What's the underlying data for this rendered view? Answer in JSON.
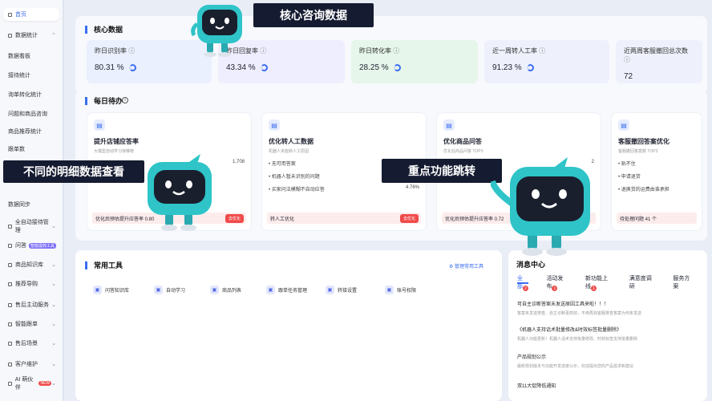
{
  "sidebar": {
    "items": [
      {
        "label": "首页",
        "active": true
      },
      {
        "label": "数据统计",
        "chevron": "⌃"
      },
      {
        "label": "数据看板"
      },
      {
        "label": "接待统计"
      },
      {
        "label": "询单转化统计"
      },
      {
        "label": "问题和商品咨询"
      },
      {
        "label": "商品推荐统计"
      },
      {
        "label": "跟单数"
      },
      {
        "label": "数据同步"
      },
      {
        "label": "全自动接待管理",
        "chevron": "⌄"
      },
      {
        "label": "问答",
        "badge": "智能提效工具"
      },
      {
        "label": "商品知识库",
        "chevron": "⌄"
      },
      {
        "label": "推荐导购",
        "chevron": "⌄"
      },
      {
        "label": "售后主动服务",
        "chevron": "⌄"
      },
      {
        "label": "智能跟单",
        "chevron": "⌄"
      },
      {
        "label": "售后场景",
        "chevron": "⌄"
      },
      {
        "label": "客户维护",
        "chevron": "⌄"
      },
      {
        "label": "AI 萌伙伴",
        "new": "NEW",
        "chevron": "⌄"
      }
    ]
  },
  "core": {
    "title": "核心数据",
    "stats": [
      {
        "label": "昨日识别率",
        "value": "80.31 %",
        "color": "#eaf0fd"
      },
      {
        "label": "昨日回复率",
        "value": "43.34 %",
        "color": "#efeefe"
      },
      {
        "label": "昨日转化率",
        "value": "28.25 %",
        "color": "#e6f6ea"
      },
      {
        "label": "近一周转人工率",
        "value": "91.23 %",
        "color": "#eef1fb"
      },
      {
        "label": "近两周客服撤回总次数",
        "value": "72",
        "color": "#eef1fb"
      }
    ]
  },
  "todo": {
    "title": "每日待办",
    "tasks": [
      {
        "title": "提升店铺应答率",
        "sub": "大模型自动学习待推荐",
        "rows": [
          {
            "k": "",
            "v": "1,708"
          },
          {
            "k": "",
            "v": ""
          },
          {
            "k": "待优化问法模糊",
            "v": ""
          }
        ],
        "footer": "优化后预估提升应答率 0.80",
        "button": "去优化"
      },
      {
        "title": "优化转人工数据",
        "sub": "机器人未能转人工原因",
        "rows": [
          {
            "k": "• 无可用答案",
            "v": "73.0"
          },
          {
            "k": "• 机器人暂未识别的问题",
            "v": "15.3"
          },
          {
            "k": "• 买家问法模糊不自动应答",
            "v": "4.76%"
          }
        ],
        "footer": "转人工优化",
        "button": "去优化"
      },
      {
        "title": "优化商品问答",
        "sub": "优化后商品问答 TOP3",
        "rows": [
          {
            "k": "",
            "v": "2"
          },
          {
            "k": "",
            "v": ""
          },
          {
            "k": "",
            "v": ""
          }
        ],
        "footer": "优化后预估提升应答率 0.72",
        "button": ""
      },
      {
        "title": "客服撤回答案优化",
        "sub": "客服撤回答案数 TOP3",
        "rows": [
          {
            "k": "• 贴不住",
            "v": ""
          },
          {
            "k": "• 申请退货",
            "v": ""
          },
          {
            "k": "• 退换货的运费由谁承担",
            "v": ""
          }
        ],
        "footer": "待处理问题 41 个",
        "button": ""
      }
    ]
  },
  "tools": {
    "title": "常用工具",
    "manage": "管理常用工具",
    "items": [
      "问答知识库",
      "自动学习",
      "商品列表",
      "跟单任务管理",
      "转接设置",
      "账号权限"
    ]
  },
  "messages": {
    "title": "消息中心",
    "tabs": [
      {
        "label": "全部",
        "badge": "2"
      },
      {
        "label": "活动发布",
        "badge": "1"
      },
      {
        "label": "新功能上线",
        "badge": "1"
      },
      {
        "label": "满意度调研"
      },
      {
        "label": "服务方案"
      }
    ],
    "items": [
      {
        "title": "可自主诊断答案未发送原因工具来啦！！！",
        "sub": "答案未发送排查、自主诊断更高效，不用再找客服排查答案为何未发送"
      },
      {
        "title": "《机器人支持话术批量修改&时效标签批量删除》",
        "sub": "机器人功能更新！机器人话术支持批量修改、时效标签支持批量删除"
      },
      {
        "title": "产品规划公示",
        "sub": "最新规划版本与功能开发进度公示，欢迎提出您的产品需求和建议"
      },
      {
        "title": "双11大促降低通知",
        "sub": ""
      }
    ]
  },
  "banners": {
    "top": "核心咨询数据",
    "left": "不同的明细数据查看",
    "mid": "重点功能跳转"
  }
}
